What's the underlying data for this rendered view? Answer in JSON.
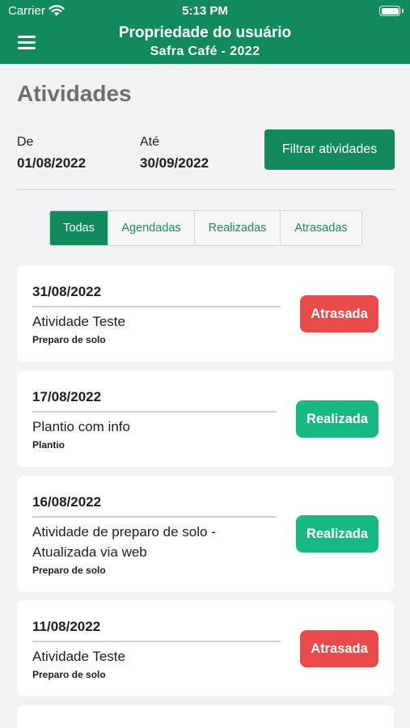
{
  "status_bar": {
    "carrier": "Carrier",
    "time": "5:13 PM",
    "icons": [
      "wifi-icon",
      "battery-icon"
    ]
  },
  "nav": {
    "title": "Propriedade do usuário",
    "subtitle": "Safra Café - 2022",
    "menu_icon": "menu-icon"
  },
  "page_title": "Atividades",
  "filter": {
    "from_label": "De",
    "from_value": "01/08/2022",
    "to_label": "Até",
    "to_value": "30/09/2022",
    "button_label": "Filtrar atividades"
  },
  "tabs": [
    {
      "label": "Todas",
      "active": true
    },
    {
      "label": "Agendadas",
      "active": false
    },
    {
      "label": "Realizadas",
      "active": false
    },
    {
      "label": "Atrasadas",
      "active": false
    }
  ],
  "activities": [
    {
      "date": "31/08/2022",
      "title": "Atividade Teste",
      "category": "Preparo de solo",
      "status": "Atrasada"
    },
    {
      "date": "17/08/2022",
      "title": "Plantio com info",
      "category": "Plantio",
      "status": "Realizada"
    },
    {
      "date": "16/08/2022",
      "title": "Atividade de preparo de solo - Atualizada via web",
      "category": "Preparo de solo",
      "status": "Realizada"
    },
    {
      "date": "11/08/2022",
      "title": "Atividade Teste",
      "category": "Preparo de solo",
      "status": "Atrasada"
    }
  ],
  "colors": {
    "primary": "#118a5c",
    "late": "#ea4a4a",
    "done": "#15b981",
    "background": "#f2f2f4"
  }
}
